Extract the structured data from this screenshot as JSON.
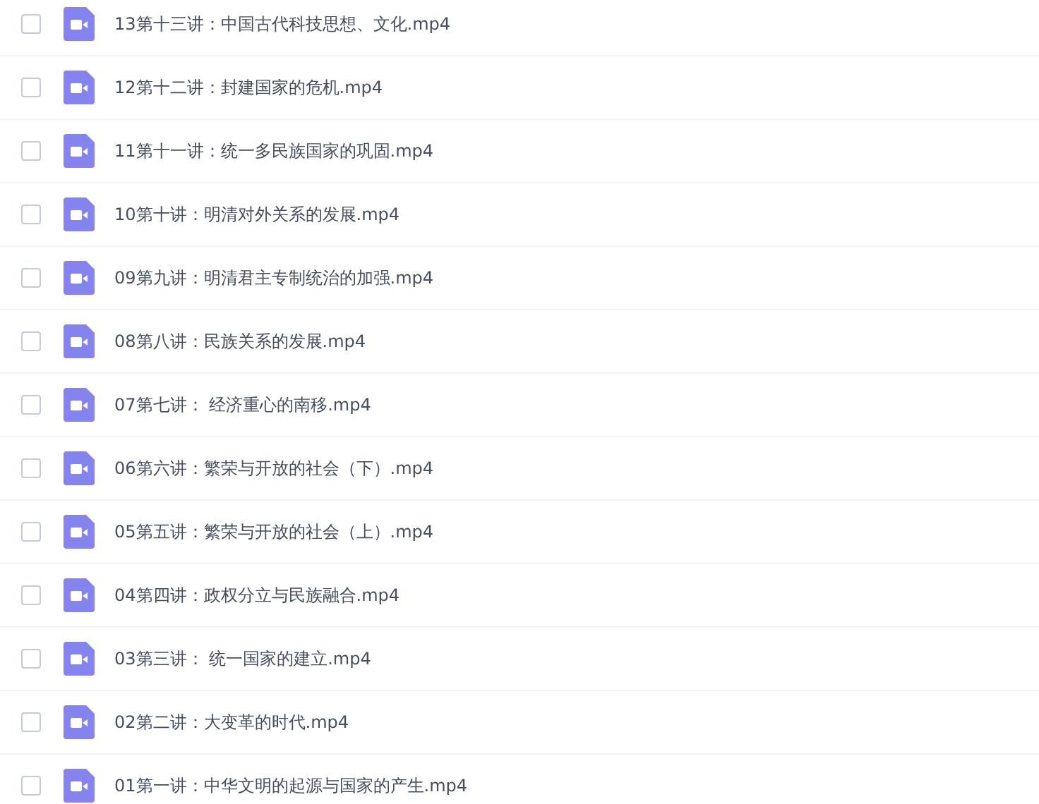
{
  "files": [
    {
      "name": "13第十三讲：中国古代科技思想、文化.mp4",
      "checked": false
    },
    {
      "name": "12第十二讲：封建国家的危机.mp4",
      "checked": false
    },
    {
      "name": "11第十一讲：统一多民族国家的巩固.mp4",
      "checked": false
    },
    {
      "name": "10第十讲：明清对外关系的发展.mp4",
      "checked": false
    },
    {
      "name": "09第九讲：明清君主专制统治的加强.mp4",
      "checked": false
    },
    {
      "name": "08第八讲：民族关系的发展.mp4",
      "checked": false
    },
    {
      "name": "07第七讲： 经济重心的南移.mp4",
      "checked": false
    },
    {
      "name": "06第六讲：繁荣与开放的社会（下）.mp4",
      "checked": false
    },
    {
      "name": "05第五讲：繁荣与开放的社会（上）.mp4",
      "checked": false
    },
    {
      "name": "04第四讲：政权分立与民族融合.mp4",
      "checked": false
    },
    {
      "name": "03第三讲： 统一国家的建立.mp4",
      "checked": false
    },
    {
      "name": "02第二讲：大变革的时代.mp4",
      "checked": false
    },
    {
      "name": "01第一讲：中华文明的起源与国家的产生.mp4",
      "checked": false
    }
  ]
}
